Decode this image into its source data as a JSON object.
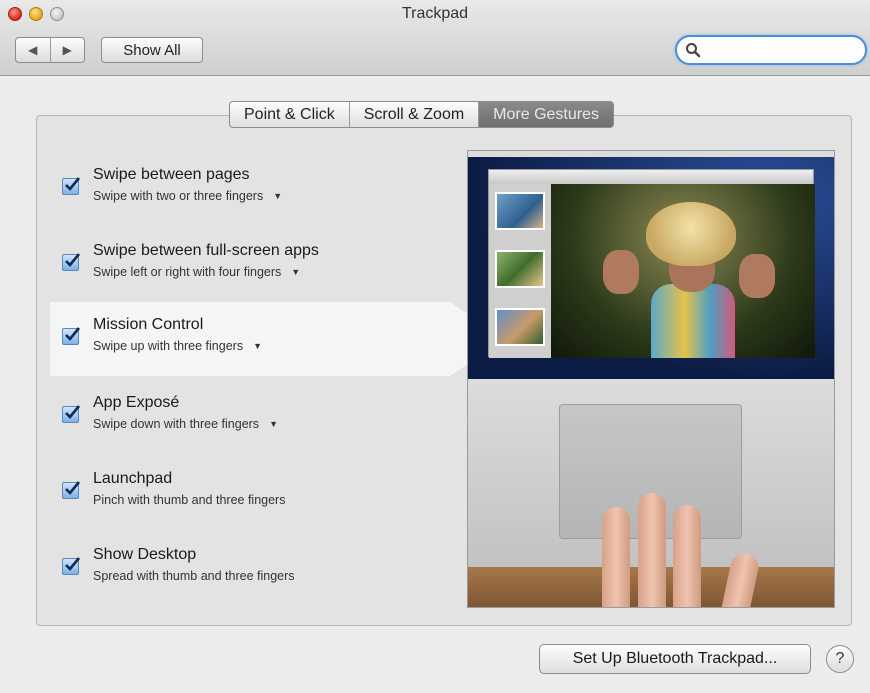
{
  "window": {
    "title": "Trackpad"
  },
  "toolbar": {
    "back_icon": "◀",
    "forward_icon": "▶",
    "show_all_label": "Show All",
    "search": {
      "value": "",
      "placeholder": ""
    }
  },
  "tabs": [
    {
      "label": "Point & Click",
      "active": false
    },
    {
      "label": "Scroll & Zoom",
      "active": false
    },
    {
      "label": "More Gestures",
      "active": true
    }
  ],
  "gestures": [
    {
      "title": "Swipe between pages",
      "subtitle": "Swipe with two or three fingers",
      "has_dropdown": true,
      "checked": true,
      "selected": false
    },
    {
      "title": "Swipe between full-screen apps",
      "subtitle": "Swipe left or right with four fingers",
      "has_dropdown": true,
      "checked": true,
      "selected": false
    },
    {
      "title": "Mission Control",
      "subtitle": "Swipe up with three fingers",
      "has_dropdown": true,
      "checked": true,
      "selected": true
    },
    {
      "title": "App Exposé",
      "subtitle": "Swipe down with three fingers",
      "has_dropdown": true,
      "checked": true,
      "selected": false
    },
    {
      "title": "Launchpad",
      "subtitle": "Pinch with thumb and three fingers",
      "has_dropdown": false,
      "checked": true,
      "selected": false
    },
    {
      "title": "Show Desktop",
      "subtitle": "Spread with thumb and three fingers",
      "has_dropdown": false,
      "checked": true,
      "selected": false
    }
  ],
  "footer": {
    "setup_bluetooth_label": "Set Up Bluetooth Trackpad...",
    "help_label": "?"
  },
  "colors": {
    "accent": "#4a8fd6",
    "active_tab": "#7a7a7a",
    "checkbox": "#7fb0ea"
  }
}
